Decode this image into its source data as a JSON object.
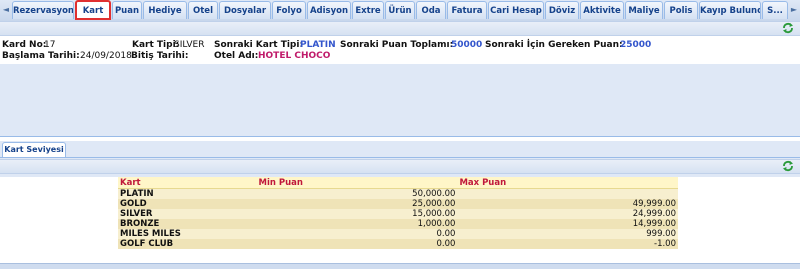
{
  "tabs": {
    "left_arrow": "◄",
    "right_arrow": "►",
    "items": [
      "Rezervasyon",
      "Kart",
      "Puan",
      "Hediye",
      "Otel",
      "Dosyalar",
      "Folyo",
      "Adisyon",
      "Extre",
      "Ürün",
      "Oda",
      "Fatura",
      "Cari Hesap",
      "Döviz",
      "Aktivite",
      "Maliye",
      "Polis",
      "Kayıp Bulundu",
      "S..."
    ],
    "active": "Kart"
  },
  "card": {
    "kard_no_label": "Kard No:",
    "kard_no": "17",
    "kart_tipi_label": "Kart Tipi:",
    "kart_tipi": "SILVER",
    "sonraki_kart_tipi_label": "Sonraki Kart Tipi:",
    "sonraki_kart_tipi": "PLATIN",
    "sonraki_puan_label": "Sonraki Puan Toplamı:",
    "sonraki_puan": "50000",
    "gereken_puan_label": "Sonraki İçin Gereken Puan:",
    "gereken_puan": "25000",
    "baslama_label": "Başlama Tarihi:",
    "baslama": "24/09/2018",
    "bitis_label": "Bitiş Tarihi:",
    "bitis": "",
    "otel_label": "Otel Adı:",
    "otel": "HOTEL CHOCO"
  },
  "lower": {
    "subtab": "Kart Seviyesi",
    "columns": [
      "Kart",
      "Min Puan",
      "Max Puan"
    ],
    "rows": [
      {
        "kart": "PLATIN",
        "min": "50,000.00",
        "max": ""
      },
      {
        "kart": "GOLD",
        "min": "25,000.00",
        "max": "49,999.00"
      },
      {
        "kart": "SILVER",
        "min": "15,000.00",
        "max": "24,999.00"
      },
      {
        "kart": "BRONZE",
        "min": "1,000.00",
        "max": "14,999.00"
      },
      {
        "kart": "MILES MILES",
        "min": "0.00",
        "max": "999.00"
      },
      {
        "kart": "GOLF CLUB",
        "min": "0.00",
        "max": "-1.00"
      }
    ]
  },
  "icons": {
    "refresh": "refresh-icon"
  },
  "colors": {
    "accent": "#15428b",
    "active_tab_border": "#e03030",
    "header_text": "#c0173a"
  }
}
